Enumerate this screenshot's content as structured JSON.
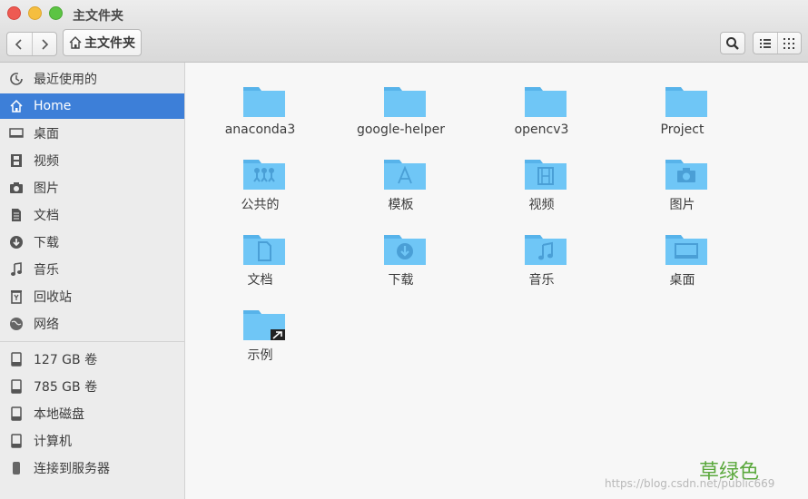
{
  "window": {
    "title": "主文件夹"
  },
  "toolbar": {
    "path_label": "主文件夹"
  },
  "sidebar": {
    "places": [
      {
        "label": "最近使用的",
        "icon": "recent-icon"
      },
      {
        "label": "Home",
        "icon": "home-icon"
      },
      {
        "label": "桌面",
        "icon": "desktop-icon"
      },
      {
        "label": "视频",
        "icon": "video-icon"
      },
      {
        "label": "图片",
        "icon": "camera-icon"
      },
      {
        "label": "文档",
        "icon": "document-icon"
      },
      {
        "label": "下载",
        "icon": "download-icon"
      },
      {
        "label": "音乐",
        "icon": "music-icon"
      },
      {
        "label": "回收站",
        "icon": "trash-icon"
      },
      {
        "label": "网络",
        "icon": "network-icon"
      }
    ],
    "devices": [
      {
        "label": "127 GB 卷",
        "icon": "drive-icon"
      },
      {
        "label": "785 GB 卷",
        "icon": "drive-icon"
      },
      {
        "label": "本地磁盘",
        "icon": "drive-icon"
      },
      {
        "label": "计算机",
        "icon": "drive-icon"
      },
      {
        "label": "连接到服务器",
        "icon": "server-icon"
      }
    ]
  },
  "files": [
    {
      "label": "anaconda3",
      "icon": "folder-icon"
    },
    {
      "label": "google-helper",
      "icon": "folder-icon"
    },
    {
      "label": "opencv3",
      "icon": "folder-icon"
    },
    {
      "label": "Project",
      "icon": "folder-icon"
    },
    {
      "label": "公共的",
      "icon": "folder-public-icon"
    },
    {
      "label": "模板",
      "icon": "folder-templates-icon"
    },
    {
      "label": "视频",
      "icon": "folder-videos-icon"
    },
    {
      "label": "图片",
      "icon": "folder-pictures-icon"
    },
    {
      "label": "文档",
      "icon": "folder-documents-icon"
    },
    {
      "label": "下载",
      "icon": "folder-download-icon"
    },
    {
      "label": "音乐",
      "icon": "folder-music-icon"
    },
    {
      "label": "桌面",
      "icon": "folder-desktop-icon"
    },
    {
      "label": "示例",
      "icon": "folder-link-icon"
    }
  ],
  "overlay": {
    "green_text": "草绿色",
    "watermark": "https://blog.csdn.net/public669"
  },
  "colors": {
    "selection": "#3d7fd8",
    "folder": "#6fc6f6",
    "folder_dark": "#57b3ea",
    "green_text": "#5aa83c"
  }
}
